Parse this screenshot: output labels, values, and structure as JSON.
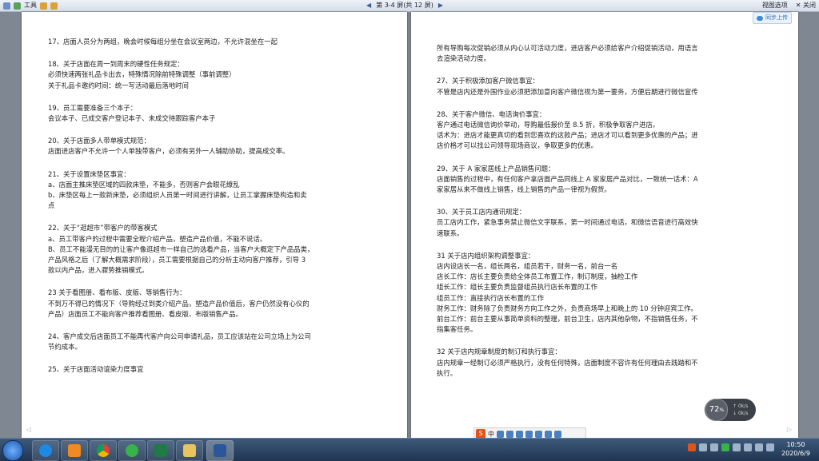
{
  "toolbar": {
    "left_label": "工具",
    "page_indicator": "第 3-4 屏(共 12 屏)",
    "right_menu": "视图选项",
    "close_label": "关闭"
  },
  "cloud_button": "同步上传",
  "left_page": [
    {
      "lines": [
        "17、店面人员分为两组，晚会时候每组分坐在会议室两边，不允许混坐在一起"
      ]
    },
    {
      "lines": [
        "18、关于店面在周一到周末的硬性任务规定：",
        "必须快速两张礼品卡出去，特殊情况除前特殊调整（事前调整）",
        "关于礼品卡邀约时间：统一写活动最后落地时间"
      ]
    },
    {
      "lines": [
        "19、员工需要准备三个本子：",
        "会议本子、已成交客户登记本子、未成交待跟踪客户本子"
      ]
    },
    {
      "lines": [
        "20、关于店面多人带单模式规范：",
        "店面进店客户不允许一个人单独带客户，必须有另外一人辅助协助，提高成交率。"
      ]
    },
    {
      "lines": [
        "21、关于设置床垫区事宜：",
        "a、店面主推床垫区域的四款床垫，不能多，否则客户会眼花缭乱",
        "b、床垫区每上一款新床垫，必须组织人员第一时间进行讲解，让员工掌握床垫构造和卖",
        "点"
      ]
    },
    {
      "lines": [
        "22、关于“逛超市”带客户的带客模式",
        "a、员工带客户的过程中需要全程介绍产品，塑造产品价值，不能不说话。",
        "B、员工不能漫无目的的让客户像逛超市一样自己的选看产品，当客户大概定下产品品类，",
        "产品风格之后（了解大概需求阶段），员工需要根据自己的分析主动向客户推荐，引导 3",
        "款以内产品，进入骤势推销模式。"
      ]
    },
    {
      "lines": [
        "23 关于看图册、看布版、皮版、等销售行为：",
        "不到万不得已的情况下（导购经过到类介绍产品，塑造产品价值后，客户仍然没有心仪的",
        "产品）店面员工不能向客户推荐看图册、看皮版、布版销售产品。"
      ]
    },
    {
      "lines": [
        "24、客户成交后店面员工不能再代客户向公司申请礼品，员工应该站在公司立场上为公司",
        "节约成本。"
      ]
    },
    {
      "lines": [
        "25、关于店面活动谊染力度事宜"
      ]
    }
  ],
  "right_page": [
    {
      "lines": [
        "所有导购每次促销必须从内心认可活动力度，进店客户必须给客户介绍促销活动，用语言",
        "去渲染活动力度。"
      ]
    },
    {
      "lines": [
        "27、关于积极添加客户微信事宜：",
        "不管是店内还是外围作业必须把添加意向客户微信视为第一要务，方便后期进行微信宣传"
      ]
    },
    {
      "lines": [
        "28、关于客户微信、电话询价事宜：",
        "客户通过电话微信询价举动，导购最低报价至 8.5 折，积极争取客户进店。",
        "话术为：进店才能更真切的看到您喜欢的这款产品；进店才可以看到更多优惠的产品；进",
        "店价格才可以找公司领导现场商议，争取更多的优惠。"
      ]
    },
    {
      "lines": [
        "29、关于 A 家家居线上产品销售问题：",
        "店面销售的过程中，有任何客户拿店面产品同线上 A 家家居产品对比，一致统一话术：A",
        "家家居从来不做线上销售，线上销售的产品一律视为假货。"
      ]
    },
    {
      "lines": [
        "30、关于员工店内通讯规定：",
        "员工店内工作，紧急事务禁止微信文字联系，第一时间通过电话，和微信语音进行高效快",
        "速联系。"
      ]
    },
    {
      "lines": [
        "31 关于店内组织架构调整事宜：",
        "店内设店长一名，组长两名，组员若干，财务一名，前台一名",
        "店长工作：店长主要负责给全体员工布置工作，制订制度，抽检工作",
        "组长工作：组长主要负责监督组员执行店长布置的工作",
        "组员工作：直接执行店长布置的工作",
        "财务工作：财务除了负责财务方向工作之外，负责商场早上和晚上的 10 分钟迎宾工作。",
        "前台工作：前台主要从事简单资料的整理，前台卫生，店内其他杂物，不指销售任务，不",
        "指集客任务。"
      ]
    },
    {
      "lines": [
        "32 关于店内规章制度的制订和执行事宜：",
        "店内规章一经制订必须严格执行，没有任何特殊，店面制度不容许有任何理由去践踏和不",
        "执行。"
      ]
    }
  ],
  "speed_widget": {
    "value": "72",
    "unit": "%",
    "up": "0k/s",
    "down": "0k/s"
  },
  "ime": {
    "mode": "中"
  },
  "clock": {
    "time": "10:50",
    "date": "2020/6/9"
  },
  "colors": {
    "page_bg": "#ffffff",
    "desk_bg": "#7f8792",
    "taskbar": "#1f3552"
  }
}
